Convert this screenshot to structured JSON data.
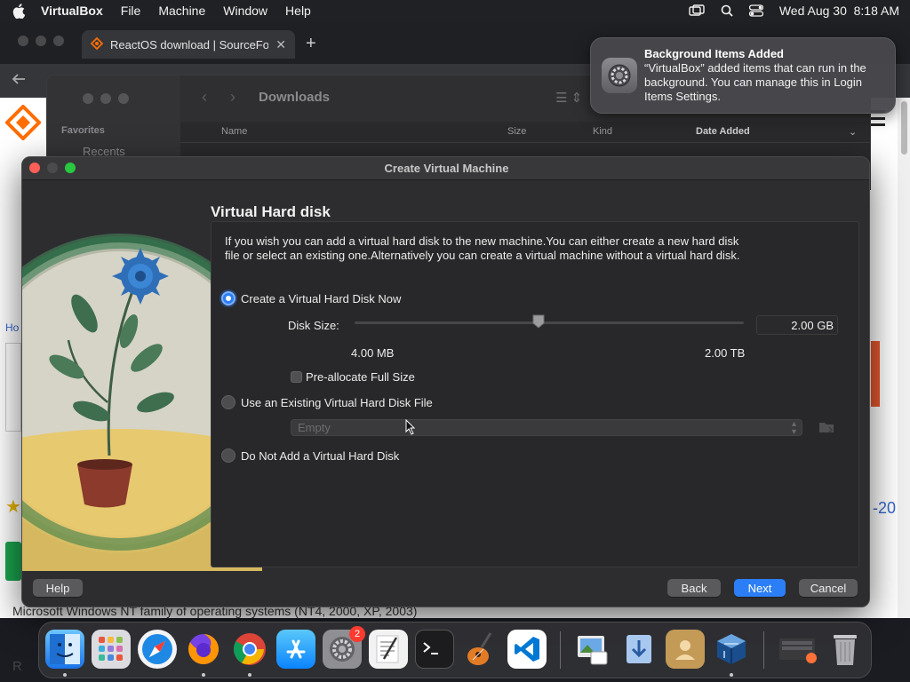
{
  "menubar": {
    "app_name": "VirtualBox",
    "menus": [
      "File",
      "Machine",
      "Window",
      "Help"
    ],
    "datetime": "Wed Aug 30  8:18 AM"
  },
  "browser": {
    "tab_title": "ReactOS download | SourceFor",
    "tab_close": "✕",
    "new_tab": "+",
    "page_text_link": "Ho",
    "page_text_right": "-20",
    "page_text_r": "R",
    "page_bottom_text": "Microsoft Windows NT family of operating systems (NT4, 2000, XP, 2003)"
  },
  "finder": {
    "title": "Downloads",
    "sidebar_section": "Favorites",
    "sidebar_item": "Recents",
    "columns": [
      "Name",
      "Size",
      "Kind",
      "Date Added"
    ]
  },
  "notification": {
    "title": "Background Items Added",
    "body": "“VirtualBox” added items that can run in the background. You can manage this in Login Items Settings."
  },
  "dialog": {
    "title": "Create Virtual Machine",
    "section_title": "Virtual Hard disk",
    "description": "If you wish you can add a virtual hard disk to the new machine.You can either create a new hard disk file or select an existing one.Alternatively you can create a virtual machine without a virtual hard disk.",
    "option_create": "Create a Virtual Hard Disk Now",
    "disk_size_label": "Disk Size:",
    "disk_size_value": "2.00 GB",
    "disk_size_min": "4.00 MB",
    "disk_size_max": "2.00 TB",
    "disk_size_fraction": 0.48,
    "preallocate_label": "Pre-allocate Full Size",
    "option_existing": "Use an Existing Virtual Hard Disk File",
    "existing_file_value": "Empty",
    "option_none": "Do Not Add a Virtual Hard Disk",
    "selected_option": "create",
    "buttons": {
      "help": "Help",
      "back": "Back",
      "next": "Next",
      "cancel": "Cancel"
    }
  },
  "dock": {
    "items": [
      "finder-icon",
      "launchpad-icon",
      "safari-icon",
      "firefox-icon",
      "chrome-icon",
      "app-store-icon",
      "system-settings-icon",
      "textedit-icon",
      "terminal-icon",
      "garageband-icon",
      "vscode-icon",
      "preview-icon",
      "downloads-icon",
      "contacts-icon",
      "virtualbox-icon",
      "window-stack-icon",
      "trash-icon"
    ],
    "settings_badge": "2"
  },
  "colors": {
    "accent": "#2b7ef5",
    "dialog_bg": "#2d2d30"
  }
}
